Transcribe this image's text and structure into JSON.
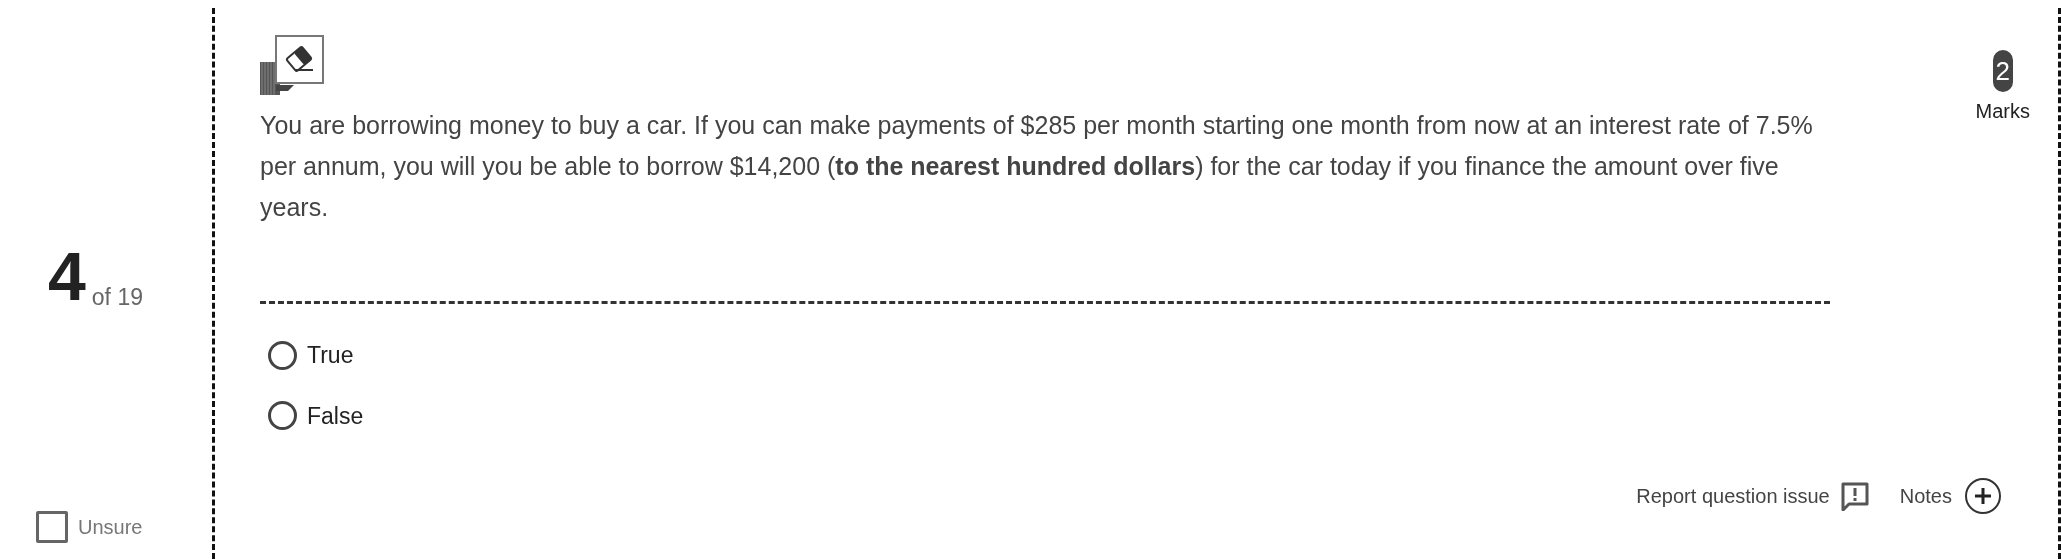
{
  "progress": {
    "number": "4",
    "total": "of 19"
  },
  "unsure": {
    "label": "Unsure",
    "checked": false
  },
  "marks": {
    "value": "2",
    "label": "Marks"
  },
  "question": {
    "text": "You are borrowing money to buy a car. If you can make payments of $285 per month starting one month from now at an interest rate of 7.5% per annum, you will you be able to borrow $14,200 (**to the nearest hundred dollars**) for the car today if you finance the amount over five years."
  },
  "options": [
    {
      "label": "True",
      "selected": false
    },
    {
      "label": "False",
      "selected": false
    }
  ],
  "actions": {
    "report": "Report question issue",
    "notes": "Notes"
  }
}
